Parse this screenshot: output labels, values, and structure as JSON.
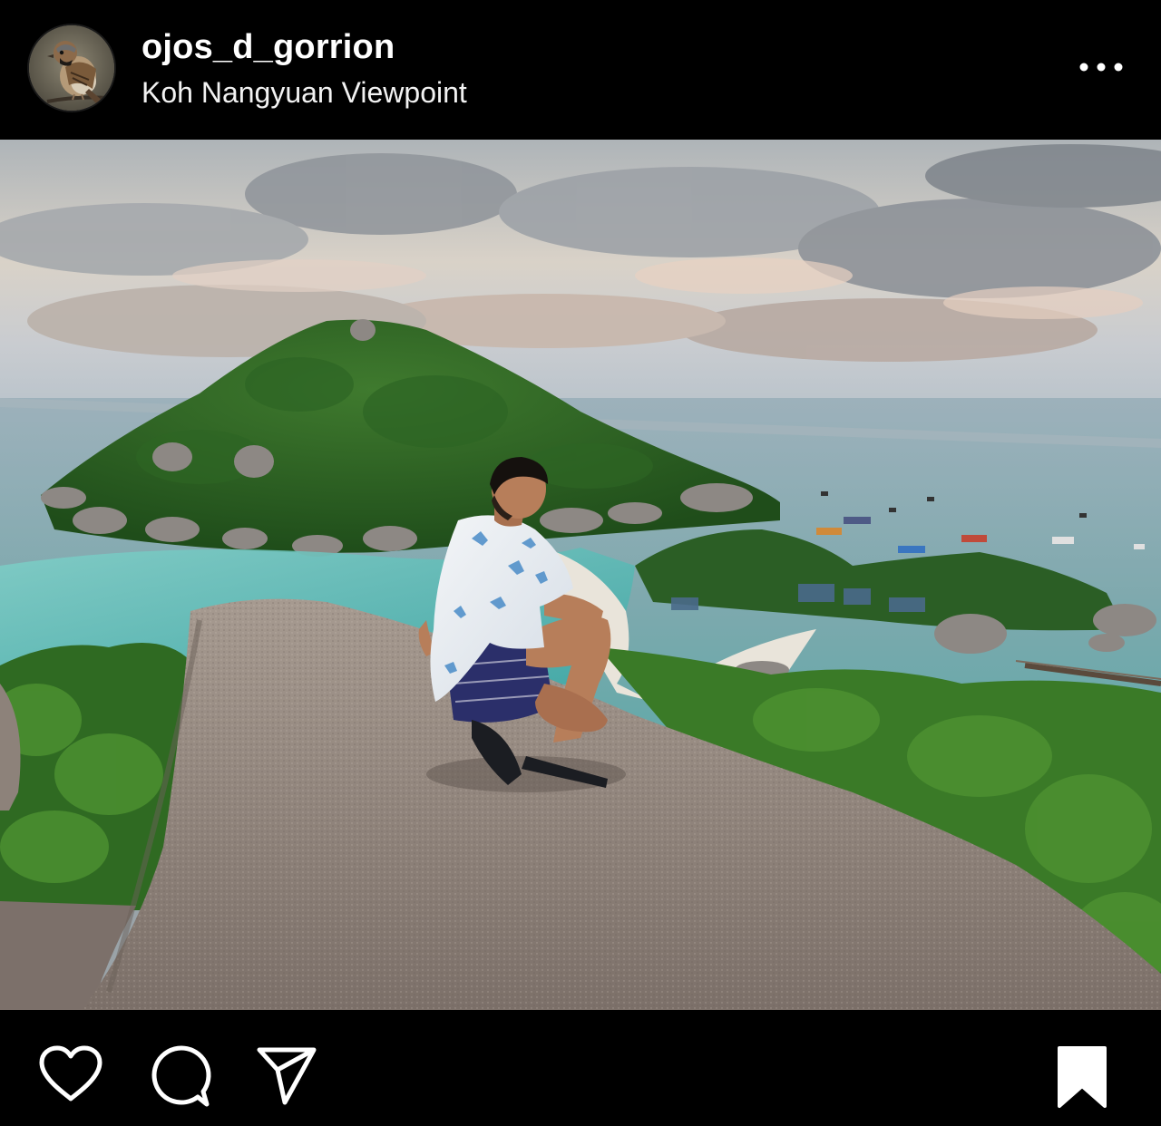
{
  "post": {
    "username": "ojos_d_gorrion",
    "location": "Koh Nangyuan Viewpoint"
  },
  "icons": {
    "more": "more-horizontal-icon",
    "like": "heart-icon",
    "comment": "comment-bubble-icon",
    "share": "paper-plane-icon",
    "save": "bookmark-filled-icon"
  },
  "colors": {
    "background": "#000000",
    "text": "#ffffff"
  }
}
